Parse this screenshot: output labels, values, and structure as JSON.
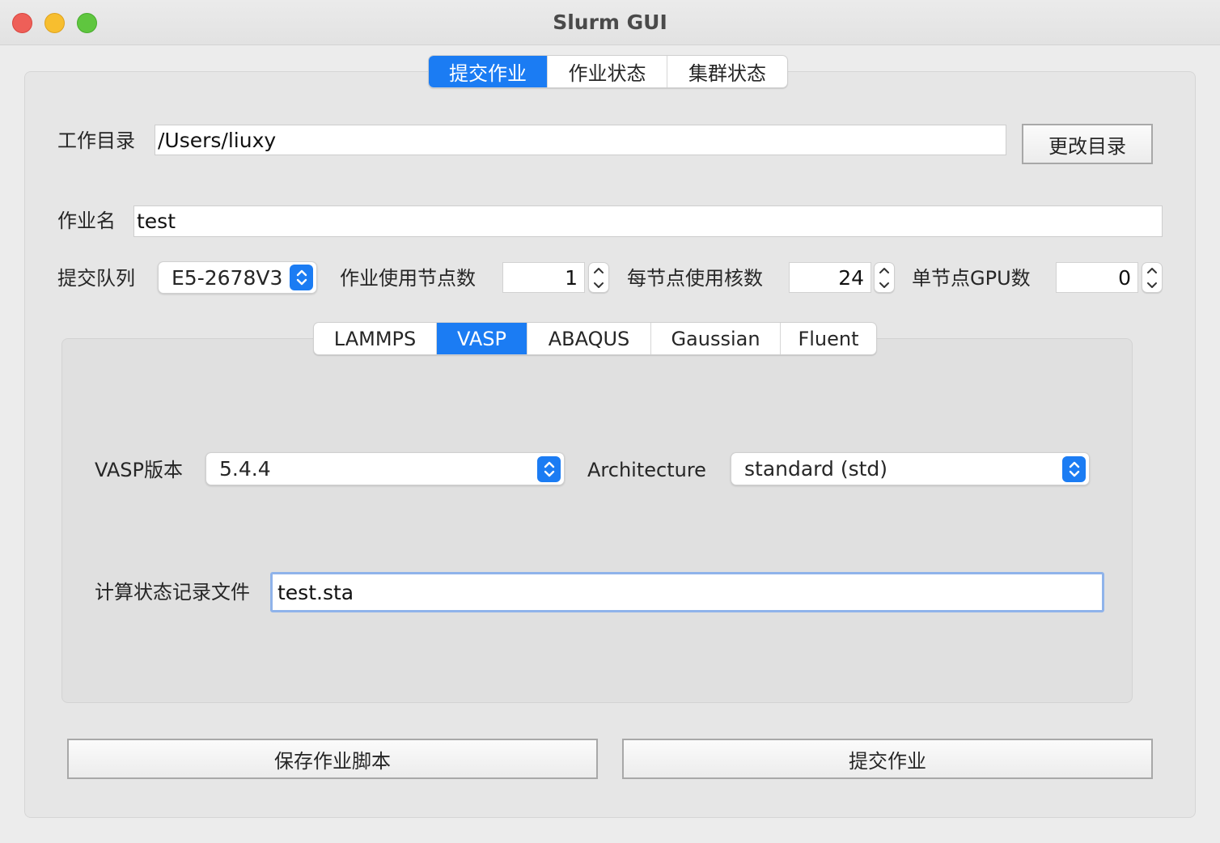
{
  "window": {
    "title": "Slurm GUI"
  },
  "main_tabs": [
    {
      "label": "提交作业",
      "active": true
    },
    {
      "label": "作业状态",
      "active": false
    },
    {
      "label": "集群状态",
      "active": false
    }
  ],
  "workdir": {
    "label": "工作目录",
    "value": "/Users/liuxy",
    "change_button": "更改目录"
  },
  "jobname": {
    "label": "作业名",
    "value": "test"
  },
  "queue": {
    "label": "提交队列",
    "value": "E5-2678V3"
  },
  "nodes": {
    "label": "作业使用节点数",
    "value": "1"
  },
  "cores": {
    "label": "每节点使用核数",
    "value": "24"
  },
  "gpus": {
    "label": "单节点GPU数",
    "value": "0"
  },
  "software_tabs": [
    {
      "label": "LAMMPS",
      "active": false
    },
    {
      "label": "VASP",
      "active": true
    },
    {
      "label": "ABAQUS",
      "active": false
    },
    {
      "label": "Gaussian",
      "active": false
    },
    {
      "label": "Fluent",
      "active": false
    }
  ],
  "vasp": {
    "version_label": "VASP版本",
    "version_value": "5.4.4",
    "arch_label": "Architecture",
    "arch_value": "standard (std)",
    "status_file_label": "计算状态记录文件",
    "status_file_value": "test.sta"
  },
  "actions": {
    "save_script": "保存作业脚本",
    "submit": "提交作业"
  },
  "colors": {
    "accent": "#1b7cf3",
    "focus_ring": "#8fb3ea",
    "window_bg": "#ececec"
  },
  "icons": {
    "popup_arrows": "chevron-up-down-icon",
    "stepper": "stepper-arrows-icon"
  }
}
